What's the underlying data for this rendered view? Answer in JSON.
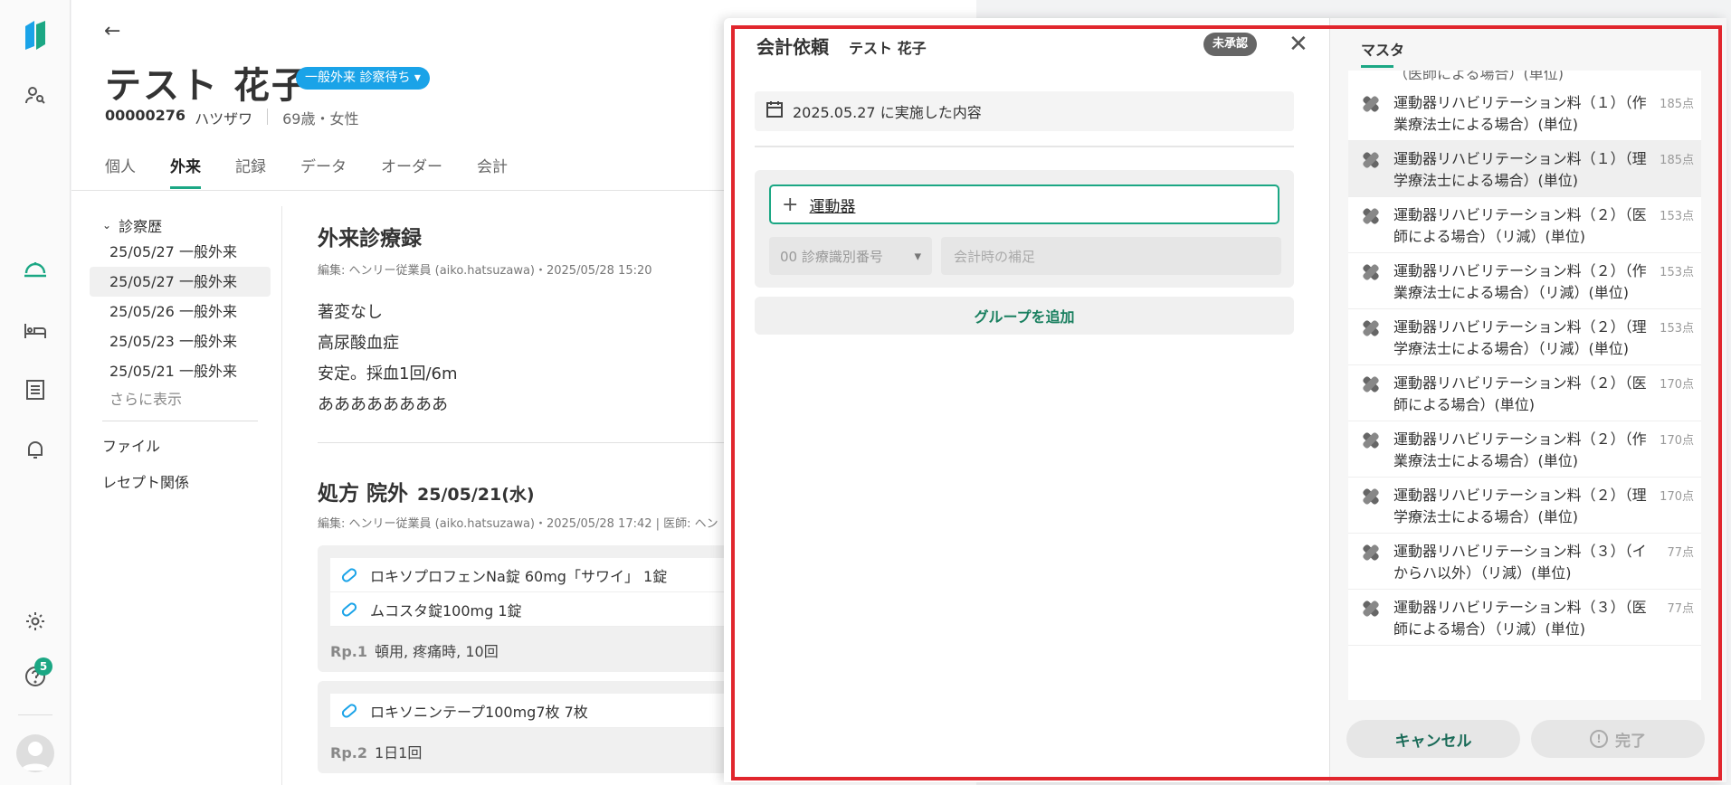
{
  "rail": {
    "help_badge": "5"
  },
  "patient": {
    "name": "テスト 花子",
    "status": "一般外来 診察待ち",
    "id": "00000276",
    "kana": "ハツザワ",
    "age_sex": "69歳・女性"
  },
  "tabs": [
    "個人",
    "外来",
    "記録",
    "データ",
    "オーダー",
    "会計"
  ],
  "history": {
    "header": "診察歴",
    "rows": [
      "25/05/27 一般外来",
      "25/05/27 一般外来",
      "25/05/26 一般外来",
      "25/05/23 一般外来",
      "25/05/21 一般外来"
    ],
    "more": "さらに表示",
    "links": [
      "ファイル",
      "レセプト関係"
    ]
  },
  "record": {
    "title": "外来診療録",
    "edited": "編集: ヘンリー従業員 (aiko.hatsuzawa)・2025/05/28 15:20",
    "lines": [
      "著変なし",
      "高尿酸血症",
      "安定。採血1回/6m",
      "ああああああああ"
    ],
    "rx_title": "処方 院外",
    "rx_date": "25/05/21(水)",
    "rx_edited": "編集: ヘンリー従業員 (aiko.hatsuzawa)・2025/05/28 17:42 | 医師: ヘン",
    "rp1": [
      "ロキソプロフェンNa錠 60mg「サワイ」 1錠",
      "ムコスタ錠100mg 1錠"
    ],
    "rp1_label": "Rp.1",
    "rp1_note": "頓用, 疼痛時, 10回",
    "rp2": [
      "ロキソニンテープ100mg7枚 7枚"
    ],
    "rp2_label": "Rp.2",
    "rp2_note": "1日1回"
  },
  "modal": {
    "title": "会計依頼",
    "patient": "テスト 花子",
    "badge": "未承認",
    "date_label": "2025.05.27 に実施した内容",
    "search_value": "運動器",
    "select_placeholder": "00 診療識別番号",
    "note_placeholder": "会計時の補足",
    "add_group": "グループを追加",
    "master_tab": "マスタ",
    "cut_top": "（医師による場合）(単位)",
    "items": [
      {
        "name": "運動器リハビリテーション料（１）（作業療法士による場合）(単位)",
        "points": "185点"
      },
      {
        "name": "運動器リハビリテーション料（１）（理学療法士による場合）(単位)",
        "points": "185点"
      },
      {
        "name": "運動器リハビリテーション料（２）（医師による場合）（リ減）(単位)",
        "points": "153点"
      },
      {
        "name": "運動器リハビリテーション料（２）（作業療法士による場合）（リ減）(単位)",
        "points": "153点"
      },
      {
        "name": "運動器リハビリテーション料（２）（理学療法士による場合）（リ減）(単位)",
        "points": "153点"
      },
      {
        "name": "運動器リハビリテーション料（２）（医師による場合）(単位)",
        "points": "170点"
      },
      {
        "name": "運動器リハビリテーション料（２）（作業療法士による場合）(単位)",
        "points": "170点"
      },
      {
        "name": "運動器リハビリテーション料（２）（理学療法士による場合）(単位)",
        "points": "170点"
      },
      {
        "name": "運動器リハビリテーション料（３）（イからハ以外）（リ減）(単位)",
        "points": "77点"
      },
      {
        "name": "運動器リハビリテーション料（３）（医師による場合）（リ減）(単位)",
        "points": "77点"
      }
    ],
    "cancel": "キャンセル",
    "done": "完了"
  }
}
